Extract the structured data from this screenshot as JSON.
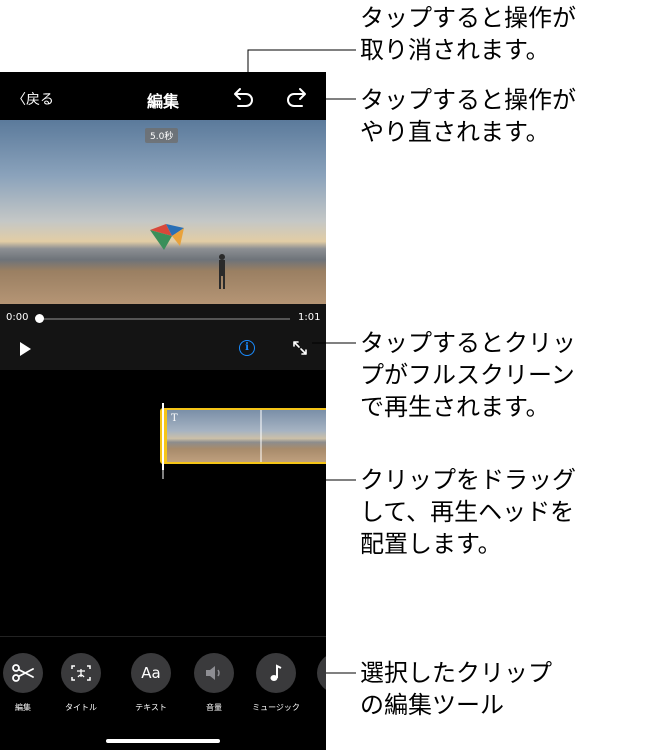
{
  "nav": {
    "back_label": "〈戻る",
    "title": "編集"
  },
  "video": {
    "duration_badge": "5.0秒"
  },
  "player": {
    "time_start": "0:00",
    "time_end": "1:01",
    "progress": 0
  },
  "tools": [
    {
      "label": "編集",
      "icon": "scissors-icon"
    },
    {
      "label": "タイトル",
      "icon": "title-icon"
    },
    {
      "label": "テキスト",
      "icon": "text-icon",
      "glyph": "Aa"
    },
    {
      "label": "音量",
      "icon": "volume-icon"
    },
    {
      "label": "ミュージック",
      "icon": "music-icon"
    }
  ],
  "callouts": {
    "undo": [
      "タップすると操作が",
      "取り消されます。"
    ],
    "redo": [
      "タップすると操作が",
      "やり直されます。"
    ],
    "fullscreen": [
      "タップするとクリッ",
      "プがフルスクリーン",
      "で再生されます。"
    ],
    "playhead": [
      "クリップをドラッグ",
      "して、再生ヘッドを",
      "配置します。"
    ],
    "tools": [
      "選択したクリップ",
      "の編集ツール"
    ]
  },
  "colors": {
    "accent_blue": "#1a8cff",
    "clip_border": "#f5c518",
    "background": "#000000"
  }
}
